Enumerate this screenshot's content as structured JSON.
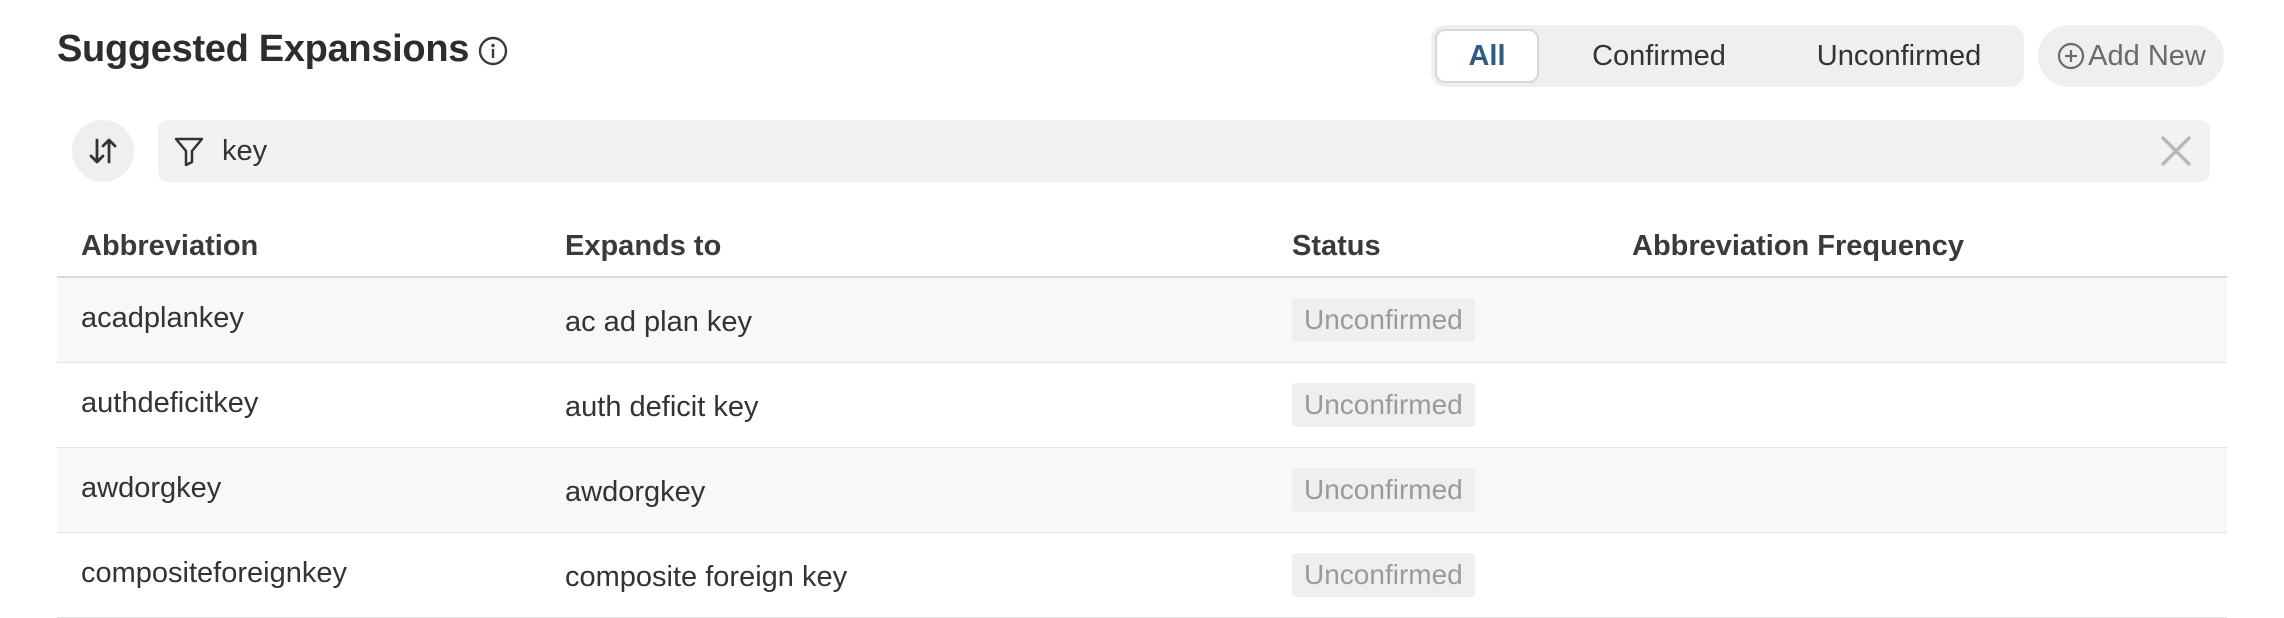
{
  "header": {
    "title": "Suggested Expansions"
  },
  "filters": {
    "all_label": "All",
    "confirmed_label": "Confirmed",
    "unconfirmed_label": "Unconfirmed",
    "selected": "All"
  },
  "add_new_label": "Add New",
  "search": {
    "value": "key"
  },
  "table": {
    "columns": [
      "Abbreviation",
      "Expands to",
      "Status",
      "Abbreviation Frequency"
    ],
    "rows": [
      {
        "abbreviation": "acadplankey",
        "expands_to": "ac ad plan key",
        "status": "Unconfirmed",
        "frequency": ""
      },
      {
        "abbreviation": "authdeficitkey",
        "expands_to": "auth deficit key",
        "status": "Unconfirmed",
        "frequency": ""
      },
      {
        "abbreviation": "awdorgkey",
        "expands_to": "awdorgkey",
        "status": "Unconfirmed",
        "frequency": ""
      },
      {
        "abbreviation": "compositeforeignkey",
        "expands_to": "composite foreign key",
        "status": "Unconfirmed",
        "frequency": ""
      }
    ]
  },
  "icons": {
    "info": "info-circle-icon",
    "add": "plus-circle-icon",
    "sort": "sort-arrows-icon",
    "filter": "filter-funnel-icon",
    "clear": "close-x-icon"
  },
  "colors": {
    "accent": "#2f5b85",
    "badge_text": "#9a9a9a",
    "surface": "#efefef"
  }
}
